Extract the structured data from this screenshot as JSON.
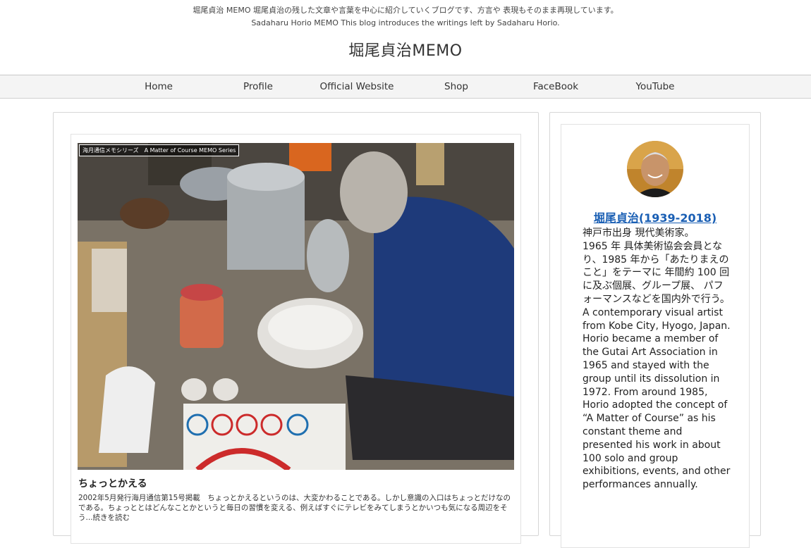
{
  "header": {
    "tagline_ja": "堀尾貞治 MEMO 堀尾貞治の残した文章や言葉を中心に紹介していくブログです、方言や 表現もそのまま再現しています。",
    "tagline_en": "Sadaharu Horio MEMO This blog introduces the writings left by Sadaharu Horio.",
    "site_title": "堀尾貞治MEMO"
  },
  "nav": {
    "items": [
      {
        "label": "Home"
      },
      {
        "label": "Profile"
      },
      {
        "label": "Official Website"
      },
      {
        "label": "Shop"
      },
      {
        "label": "FaceBook"
      },
      {
        "label": "YouTube"
      }
    ]
  },
  "post": {
    "series_badge": "海月通信メモシリーズ　A Matter of Course MEMO Series",
    "title": "ちょっとかえる",
    "excerpt": "2002年5月発行海月通信第15号掲載　ちょっとかえるというのは、大変かわることである。しかし意識の入口はちょっとだけなのである。ちょっととはどんなことかというと毎日の習慣を変える、例えばすぐにテレビをみてしまうとかいつも気になる周辺をそう...続きを読む"
  },
  "sidebar": {
    "profile_name": "堀尾貞治(1939-2018)",
    "bio_lines": [
      "神戸市出身 現代美術家。",
      "1965 年 具体美術協会会員となり、1985 年から「あたりまえのこと」をテーマに 年間約 100 回に及ぶ個展、グループ展、 パフォーマンスなどを国内外で行う。",
      "A contemporary visual artist from Kobe City, Hyogo, Japan.",
      "Horio became a member of the Gutai Art Association in 1965 and stayed with the group until its dissolution in 1972. From around 1985, Horio adopted the concept of “A Matter of Course” as his constant theme and presented his work in about 100 solo and group exhibitions, events, and other performances annually."
    ]
  },
  "colors": {
    "link": "#1a5fb4",
    "nav_bg": "#f4f4f4"
  }
}
